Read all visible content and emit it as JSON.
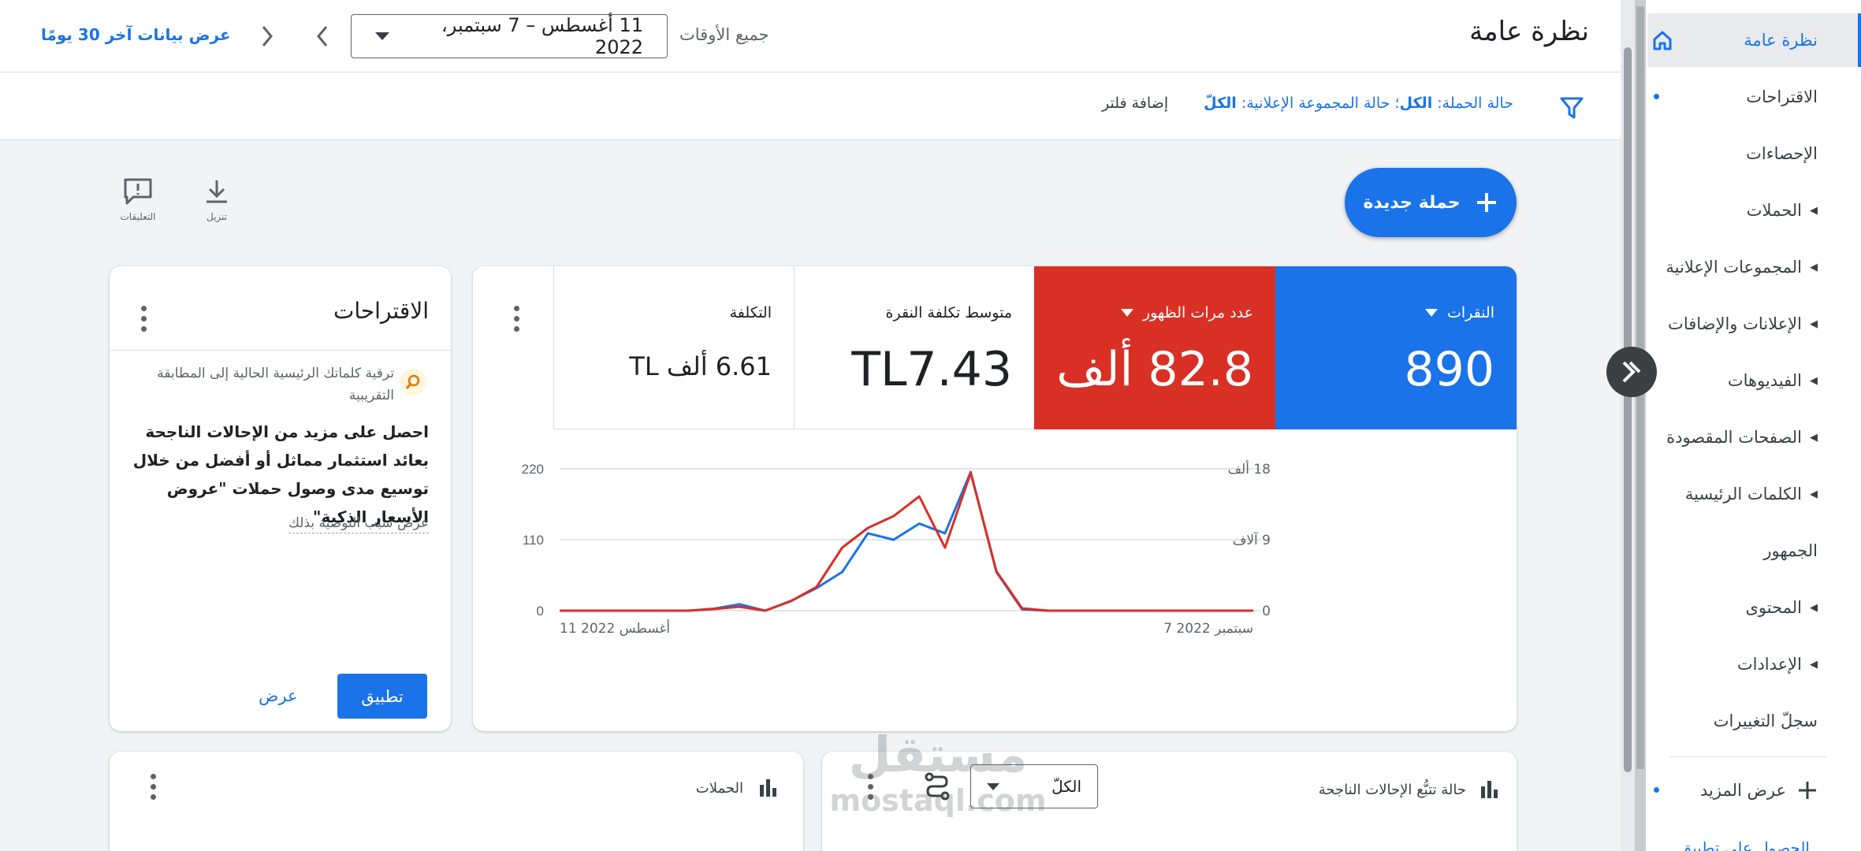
{
  "sidebar": {
    "items": [
      {
        "label": "نظرة عامة",
        "active": true,
        "caret": false,
        "icon": "home-icon"
      },
      {
        "label": "الاقتراحات",
        "caret": false,
        "dot": true
      },
      {
        "label": "الإحصاءات",
        "caret": false
      },
      {
        "label": "الحملات",
        "caret": true
      },
      {
        "label": "المجموعات الإعلانية",
        "caret": true
      },
      {
        "label": "الإعلانات والإضافات",
        "caret": true
      },
      {
        "label": "الفيديوهات",
        "caret": true
      },
      {
        "label": "الصفحات المقصودة",
        "caret": true
      },
      {
        "label": "الكلمات الرئيسية",
        "caret": true
      },
      {
        "label": "الجمهور",
        "caret": false
      },
      {
        "label": "المحتوى",
        "caret": true
      },
      {
        "label": "الإعدادات",
        "caret": true
      },
      {
        "label": "سجلّ التغييرات",
        "caret": false
      }
    ],
    "more_label": "عرض المزيد",
    "bottom_link": "الحصول على تطبيق"
  },
  "header": {
    "title": "نظرة عامة",
    "all_time_label": "جميع الأوقات",
    "date_range": "11 أغسطس – 7 سبتمبر، 2022",
    "last30_link": "عرض بيانات آخر 30 يومًا"
  },
  "filterbar": {
    "campaign_status_label": "حالة الحملة:",
    "campaign_status_value": "الكل",
    "adgroup_status_label": "؛ حالة المجموعة الإعلانية:",
    "adgroup_status_value": "الكلّ",
    "add_filter": "إضافة فلتر"
  },
  "toolbar": {
    "new_campaign": "حملة جديدة",
    "download": "تنزيل",
    "feedback": "التعليقات"
  },
  "metrics": [
    {
      "label": "النقرات",
      "value": "890",
      "bg": "#1a73e8",
      "color": "#ffffff",
      "dropdown": true
    },
    {
      "label": "عدد مرات الظهور",
      "value": "82.8 ألف",
      "bg": "#d93025",
      "color": "#ffffff",
      "dropdown": true
    },
    {
      "label": "متوسط تكلفة النقرة",
      "value": "TL7.43",
      "bg": "#ffffff",
      "color": "#202124",
      "dropdown": false
    },
    {
      "label": "التكلفة",
      "value": "6.61 ألف TL",
      "bg": "#ffffff",
      "color": "#202124",
      "dropdown": false
    }
  ],
  "chart_data": {
    "type": "line",
    "x": [
      "2022-08-11",
      "2022-08-12",
      "2022-08-13",
      "2022-08-14",
      "2022-08-15",
      "2022-08-16",
      "2022-08-17",
      "2022-08-18",
      "2022-08-19",
      "2022-08-20",
      "2022-08-21",
      "2022-08-22",
      "2022-08-23",
      "2022-08-24",
      "2022-08-25",
      "2022-08-26",
      "2022-08-27",
      "2022-08-28",
      "2022-08-29",
      "2022-08-30",
      "2022-08-31",
      "2022-09-01",
      "2022-09-02",
      "2022-09-03",
      "2022-09-04",
      "2022-09-05",
      "2022-09-06",
      "2022-09-07"
    ],
    "x_tick_labels": [
      "11 أغسطس 2022",
      "7 سبتمبر 2022"
    ],
    "series": [
      {
        "name": "النقرات",
        "color": "#1a73e8",
        "axis": "left",
        "values": [
          0,
          0,
          0,
          0,
          0,
          0,
          3,
          10,
          0,
          15,
          35,
          60,
          120,
          110,
          135,
          120,
          215,
          60,
          2,
          0,
          0,
          0,
          0,
          0,
          0,
          0,
          0,
          0
        ]
      },
      {
        "name": "عدد مرات الظهور",
        "color": "#d93025",
        "axis": "right",
        "values": [
          0,
          0,
          0,
          0,
          0,
          0,
          0.2,
          0.5,
          0,
          1.2,
          3,
          8,
          10.5,
          12,
          14.5,
          8,
          17.5,
          5,
          0.3,
          0,
          0,
          0,
          0,
          0,
          0,
          0,
          0,
          0
        ]
      }
    ],
    "y_left": {
      "ticks": [
        "0",
        "110",
        "220"
      ],
      "lim": [
        0,
        220
      ]
    },
    "y_right": {
      "ticks": [
        "0",
        "9 آلاف",
        "18 ألف"
      ],
      "lim": [
        0,
        18
      ]
    },
    "grid": true
  },
  "suggestions": {
    "title": "الاقتراحات",
    "item_title": "ترقية كلماتك الرئيسية الحالية إلى المطابقة التقريبية",
    "item_body": "احصل على مزيد من الإحالات الناجحة بعائد استثمار مماثل أو أفضل من خلال توسيع مدى وصول حملات \"عروض الأسعار الذكية\"",
    "reason_link": "عرض سبب التوصية بذلك",
    "apply_button": "تطبيق",
    "view_button": "عرض"
  },
  "bottom_cards": {
    "conversion_title": "حالة تتبُّع الإحالات الناجحة",
    "conversion_filter": "الكلّ",
    "campaigns_title": "الحملات"
  },
  "watermark": {
    "text": "mostaql.com",
    "logo": "مستقل"
  }
}
